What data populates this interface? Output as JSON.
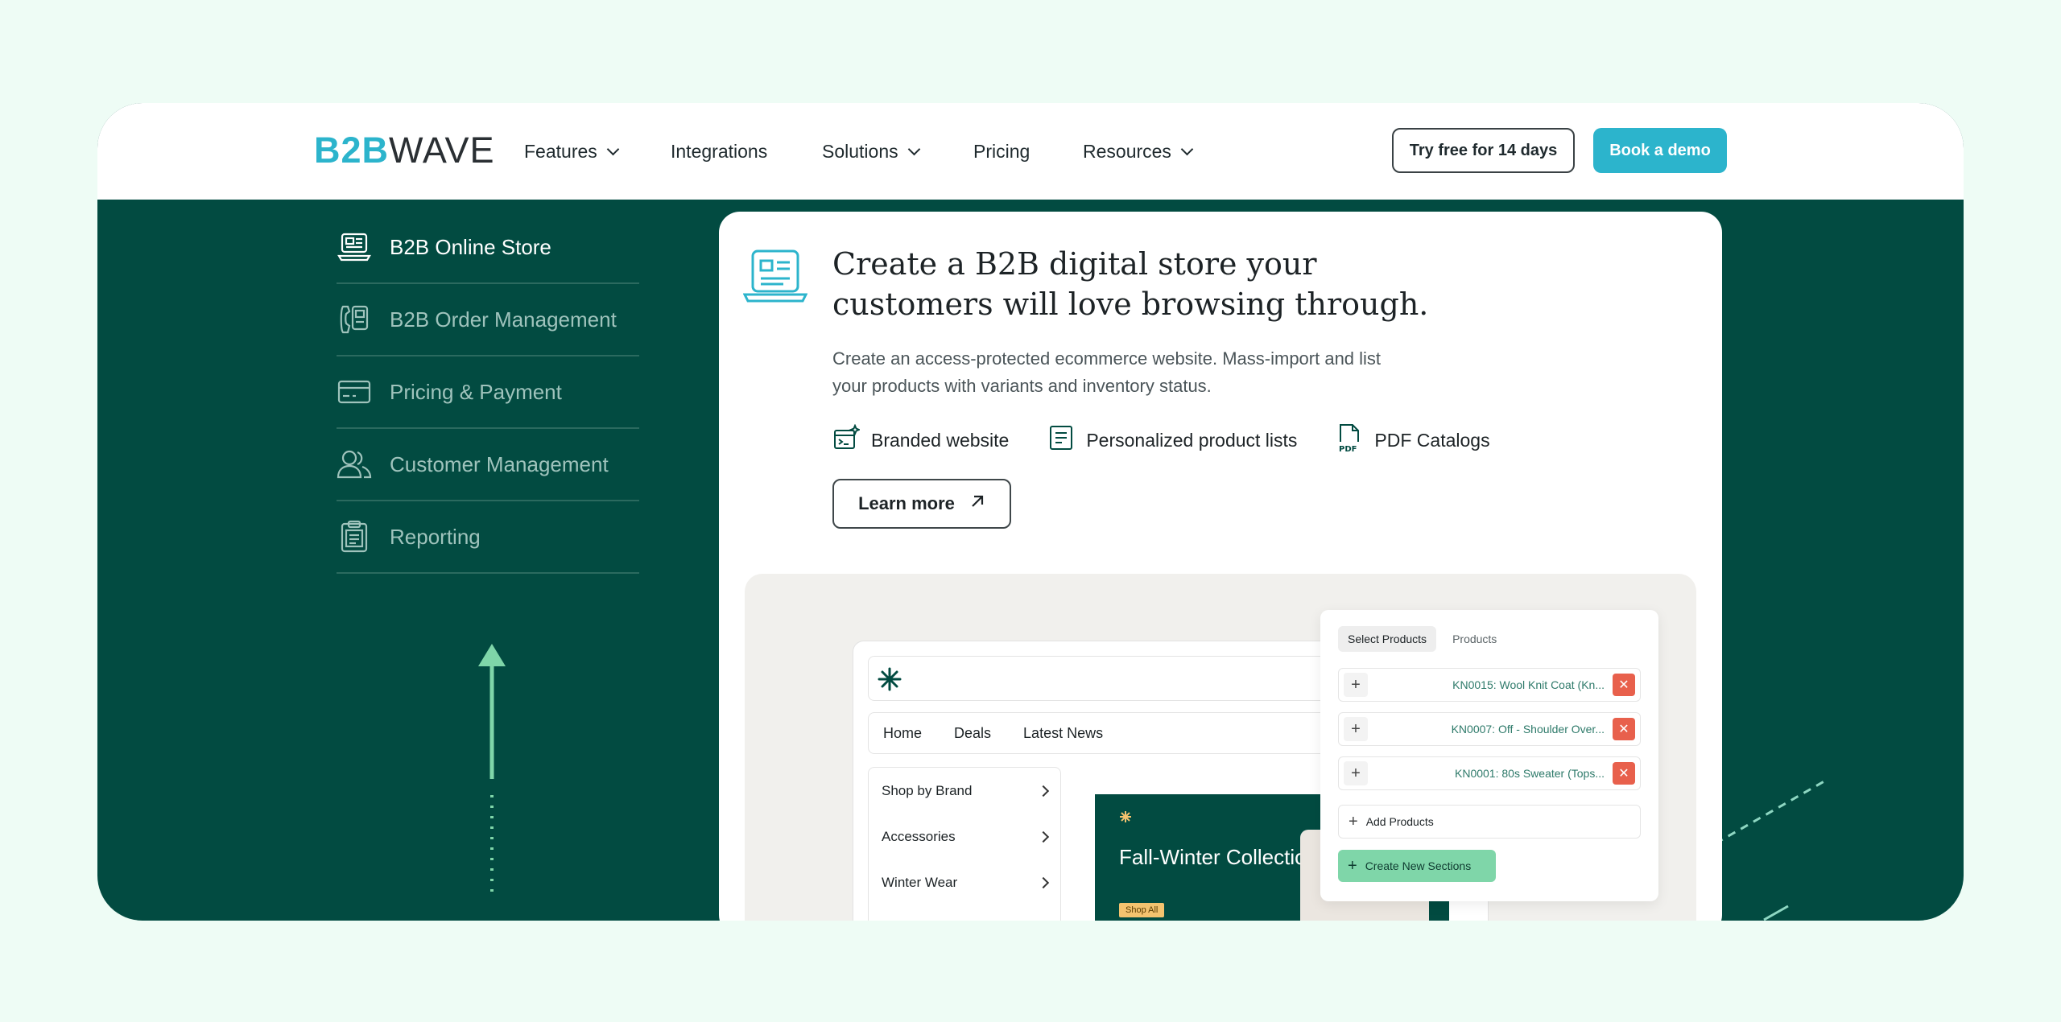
{
  "header": {
    "logo": {
      "b2b": "B2B",
      "wave": "WAVE"
    },
    "nav": [
      {
        "label": "Features",
        "dropdown": true
      },
      {
        "label": "Integrations",
        "dropdown": false
      },
      {
        "label": "Solutions",
        "dropdown": true
      },
      {
        "label": "Pricing",
        "dropdown": false
      },
      {
        "label": "Resources",
        "dropdown": true
      }
    ],
    "try_free": "Try free for 14 days",
    "book_demo": "Book a demo"
  },
  "sidebar": {
    "items": [
      {
        "label": "B2B Online Store",
        "icon": "laptop-store-icon",
        "active": true
      },
      {
        "label": "B2B Order Management",
        "icon": "phone-order-icon",
        "active": false
      },
      {
        "label": "Pricing & Payment",
        "icon": "credit-card-icon",
        "active": false
      },
      {
        "label": "Customer Management",
        "icon": "users-icon",
        "active": false
      },
      {
        "label": "Reporting",
        "icon": "clipboard-icon",
        "active": false
      }
    ]
  },
  "content": {
    "headline": "Create a B2B digital store your customers will love browsing through.",
    "description": "Create an access-protected ecommerce website. Mass-import and list your products with variants and inventory status.",
    "features": [
      {
        "label": "Branded website",
        "icon": "branded-website-icon"
      },
      {
        "label": "Personalized product lists",
        "icon": "list-document-icon"
      },
      {
        "label": "PDF Catalogs",
        "icon": "pdf-icon"
      }
    ],
    "learn_more": "Learn more"
  },
  "mockup": {
    "store_nav": [
      "Home",
      "Deals",
      "Latest News"
    ],
    "menu": [
      "Shop by Brand",
      "Accessories",
      "Winter Wear"
    ],
    "banner_title": "Fall-Winter Collection",
    "shop_all": "Shop All",
    "panel": {
      "tabs": [
        "Select Products",
        "Products"
      ],
      "rows": [
        "KN0015: Wool Knit Coat (Kn...",
        "KN0007: Off - Shoulder Over...",
        "KN0001: 80s Sweater (Tops..."
      ],
      "add_products": "Add Products",
      "create_sections": "Create New Sections"
    }
  },
  "colors": {
    "brand_teal": "#2cb4cc",
    "dark_green": "#024b41",
    "mint_bg": "#eefcf5",
    "accent_green": "#7fd6a9",
    "remove_red": "#e8604c"
  }
}
